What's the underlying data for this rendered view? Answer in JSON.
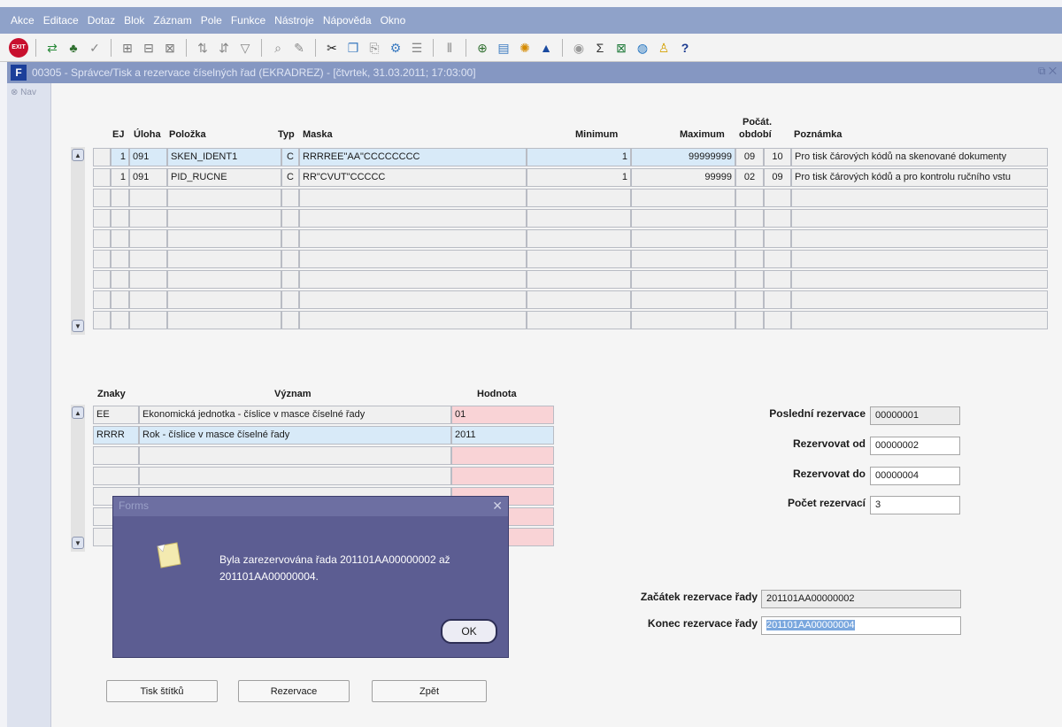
{
  "menu": [
    "Akce",
    "Editace",
    "Dotaz",
    "Blok",
    "Záznam",
    "Pole",
    "Funkce",
    "Nástroje",
    "Nápověda",
    "Okno"
  ],
  "toolbar": {
    "exit_label": "EXIT"
  },
  "window": {
    "title": "00305 - Správce/Tisk a rezervace číselných řad (EKRADREZ) - [čtvrtek, 31.03.2011; 17:03:00]",
    "nav_label": "Nav"
  },
  "top_grid": {
    "headers": {
      "ej": "EJ",
      "uloha": "Úloha",
      "polozka": "Položka",
      "typ": "Typ",
      "maska": "Maska",
      "minimum": "Minimum",
      "maximum": "Maximum",
      "pocat": "Počát.",
      "obdobi": "období",
      "poznamka": "Poznámka"
    },
    "rows": [
      {
        "ej": "1",
        "uloha": "091",
        "polozka": "SKEN_IDENT1",
        "typ": "C",
        "maska": "RRRREE\"AA\"CCCCCCCC",
        "minimum": "1",
        "maximum": "99999999",
        "obd1": "09",
        "obd2": "10",
        "poznamka": "Pro tisk čárových kódů na skenované dokumenty"
      },
      {
        "ej": "1",
        "uloha": "091",
        "polozka": "PID_RUCNE",
        "typ": "C",
        "maska": "RR\"CVUT\"CCCCC",
        "minimum": "1",
        "maximum": "99999",
        "obd1": "02",
        "obd2": "09",
        "poznamka": "Pro tisk čárových kódů a pro kontrolu ručního vstu"
      }
    ]
  },
  "bottom_grid": {
    "headers": {
      "znaky": "Znaky",
      "vyznam": "Význam",
      "hodnota": "Hodnota"
    },
    "rows": [
      {
        "znaky": "EE",
        "vyznam": "Ekonomická jednotka - číslice v masce číselné řady",
        "hodnota": "01"
      },
      {
        "znaky": "RRRR",
        "vyznam": "Rok - číslice v masce číselné řady",
        "hodnota": "2011"
      }
    ]
  },
  "reservation": {
    "posledni_label": "Poslední rezervace",
    "posledni_value": "00000001",
    "od_label": "Rezervovat od",
    "od_value": "00000002",
    "do_label": "Rezervovat do",
    "do_value": "00000004",
    "pocet_label": "Počet rezervací",
    "pocet_value": "3",
    "zacatek_label": "Začátek rezervace řady",
    "zacatek_value": "201101AA00000002",
    "konec_label": "Konec rezervace řady",
    "konec_value": "201101AA00000004"
  },
  "buttons": {
    "tisk": "Tisk štítků",
    "rezervace": "Rezervace",
    "zpet": "Zpět"
  },
  "dialog": {
    "title": "Forms",
    "message_line1": "Byla zarezervována řada 201101AA00000002 až",
    "message_line2": "201101AA00000004.",
    "ok_label": "OK"
  }
}
